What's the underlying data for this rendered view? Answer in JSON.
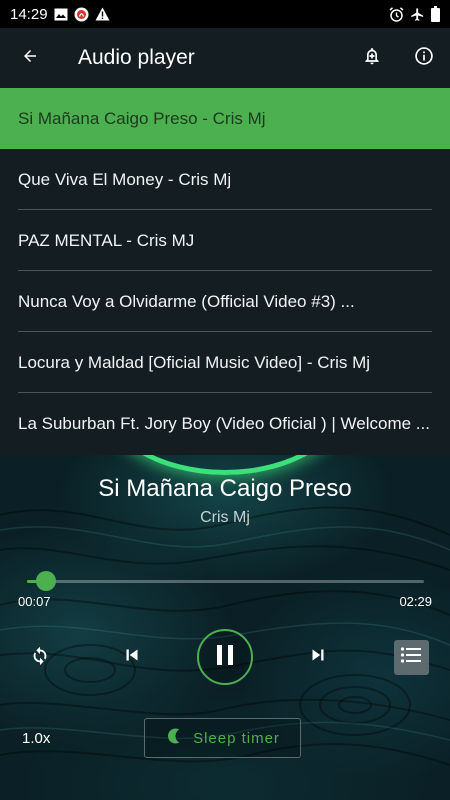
{
  "status_bar": {
    "time": "14:29",
    "left_icons": [
      "image-icon",
      "app-notification-icon",
      "warning-icon"
    ],
    "right_icons": [
      "alarm-icon",
      "airplane-mode-icon",
      "battery-icon"
    ]
  },
  "app_bar": {
    "title": "Audio player",
    "icons": [
      "back-arrow-icon",
      "notification-bell-icon",
      "info-icon"
    ]
  },
  "playlist": {
    "tracks": [
      {
        "title": "Si Mañana Caigo Preso - Cris Mj",
        "active": true
      },
      {
        "title": "Que Viva El Money - Cris Mj",
        "active": false
      },
      {
        "title": "PAZ MENTAL - Cris MJ",
        "active": false
      },
      {
        "title": "Nunca Voy a Olvidarme (Official Video #3) ...",
        "active": false
      },
      {
        "title": "Locura y Maldad [Oficial Music Video] - Cris Mj",
        "active": false
      },
      {
        "title": "La Suburban Ft. Jory Boy (Video Oficial ) | Welcome ...",
        "active": false
      }
    ]
  },
  "player": {
    "now_playing_title": "Si Mañana Caigo Preso",
    "now_playing_artist": "Cris Mj",
    "current_time": "00:07",
    "duration": "02:29",
    "progress_fraction": 0.047,
    "state": "playing",
    "speed": "1.0x",
    "sleep_timer_label": "Sleep timer",
    "accent_color": "#4caf50",
    "controls": [
      "repeat-icon",
      "skip-previous-icon",
      "pause-icon",
      "skip-next-icon",
      "playlist-icon",
      "moon-icon"
    ]
  }
}
